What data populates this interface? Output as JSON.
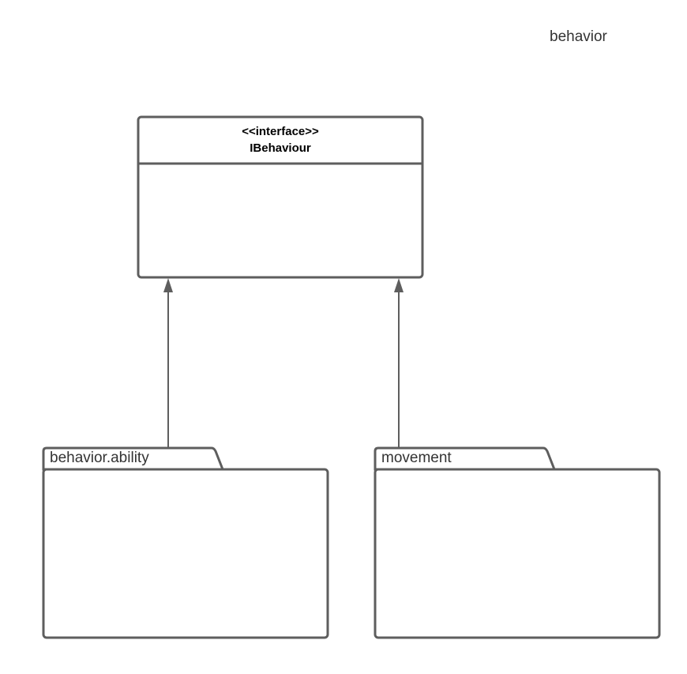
{
  "diagram": {
    "title": "behavior",
    "interface": {
      "stereotype": "<<interface>>",
      "name": "IBehaviour"
    },
    "packages": [
      {
        "label": "behavior.ability"
      },
      {
        "label": "movement"
      }
    ],
    "relationships": [
      {
        "from": "behavior.ability",
        "to": "IBehaviour",
        "type": "realization"
      },
      {
        "from": "movement",
        "to": "IBehaviour",
        "type": "realization"
      }
    ],
    "colors": {
      "stroke": "#5e5e5e",
      "text": "#333333",
      "background": "#ffffff"
    }
  }
}
